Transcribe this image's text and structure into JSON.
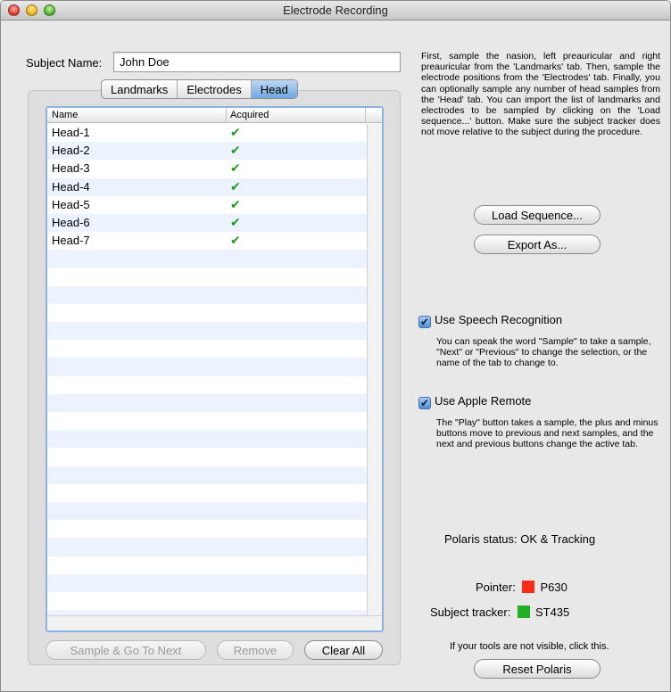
{
  "window": {
    "title": "Electrode Recording"
  },
  "subject": {
    "label": "Subject Name:",
    "value": "John Doe"
  },
  "tabs": [
    {
      "label": "Landmarks",
      "active": false
    },
    {
      "label": "Electrodes",
      "active": false
    },
    {
      "label": "Head",
      "active": true
    }
  ],
  "table": {
    "columns": [
      "Name",
      "Acquired"
    ],
    "rows": [
      {
        "name": "Head-1",
        "acquired": "✔"
      },
      {
        "name": "Head-2",
        "acquired": "✔"
      },
      {
        "name": "Head-3",
        "acquired": "✔"
      },
      {
        "name": "Head-4",
        "acquired": "✔"
      },
      {
        "name": "Head-5",
        "acquired": "✔"
      },
      {
        "name": "Head-6",
        "acquired": "✔"
      },
      {
        "name": "Head-7",
        "acquired": "✔"
      }
    ]
  },
  "buttons": {
    "sample_next": "Sample & Go To Next",
    "remove": "Remove",
    "clear_all": "Clear All",
    "load_sequence": "Load Sequence...",
    "export_as": "Export As...",
    "reset_polaris": "Reset Polaris"
  },
  "instructions": "First, sample the nasion, left preauricular and right preauricular from the 'Landmarks' tab. Then, sample the electrode positions from the 'Electrodes' tab. Finally, you can optionally sample any number of head samples from the 'Head' tab. You can import the list of landmarks and electrodes to be sampled by clicking on the 'Load sequence...' button. Make sure the subject tracker does not move relative to the subject during the procedure.",
  "speech": {
    "label": "Use Speech Recognition",
    "checked": true,
    "description": "You can speak the word \"Sample\" to take a sample, \"Next\" or \"Previous\" to change the selection, or the name of the tab to change to."
  },
  "remote": {
    "label": "Use Apple Remote",
    "checked": true,
    "description": "The \"Play\" button takes a sample, the plus and minus buttons move to previous and next samples, and the next and previous buttons change the active tab."
  },
  "polaris": {
    "status_label": "Polaris status:",
    "status_value": "OK & Tracking",
    "pointer_label": "Pointer:",
    "pointer_id": "P630",
    "pointer_color": "#ff2a1a",
    "tracker_label": "Subject tracker:",
    "tracker_id": "ST435",
    "tracker_color": "#22b022",
    "hint": "If your tools are not visible, click this."
  }
}
